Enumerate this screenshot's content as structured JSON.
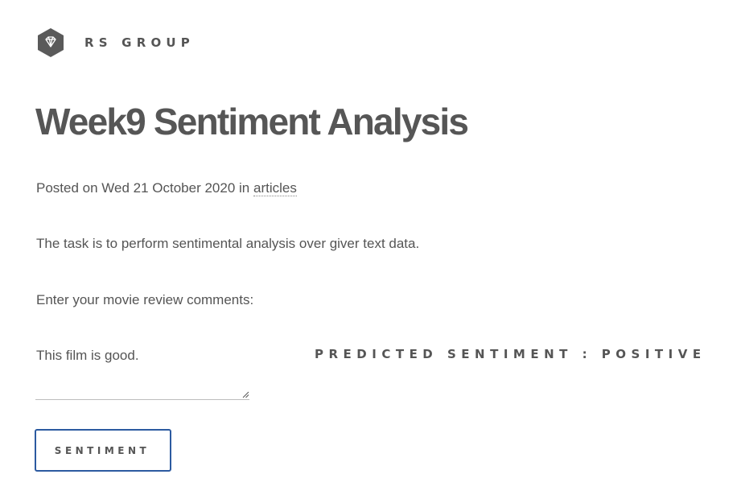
{
  "header": {
    "site_name": "RS GROUP",
    "logo_icon": "diamond-hexagon-icon"
  },
  "post": {
    "title": "Week9 Sentiment Analysis",
    "meta_prefix": "Posted on Wed 21 October 2020 in ",
    "category_link": "articles",
    "description": "The task is to perform sentimental analysis over giver text data.",
    "prompt": "Enter your movie review comments:"
  },
  "form": {
    "review_value": "This film is good.",
    "submit_label": "SENTIMENT"
  },
  "result": {
    "prediction": "PREDICTED SENTIMENT : POSITIVE"
  },
  "colors": {
    "text": "#555555",
    "logo": "#5a5a5a",
    "button_border": "#2c5aa0"
  }
}
